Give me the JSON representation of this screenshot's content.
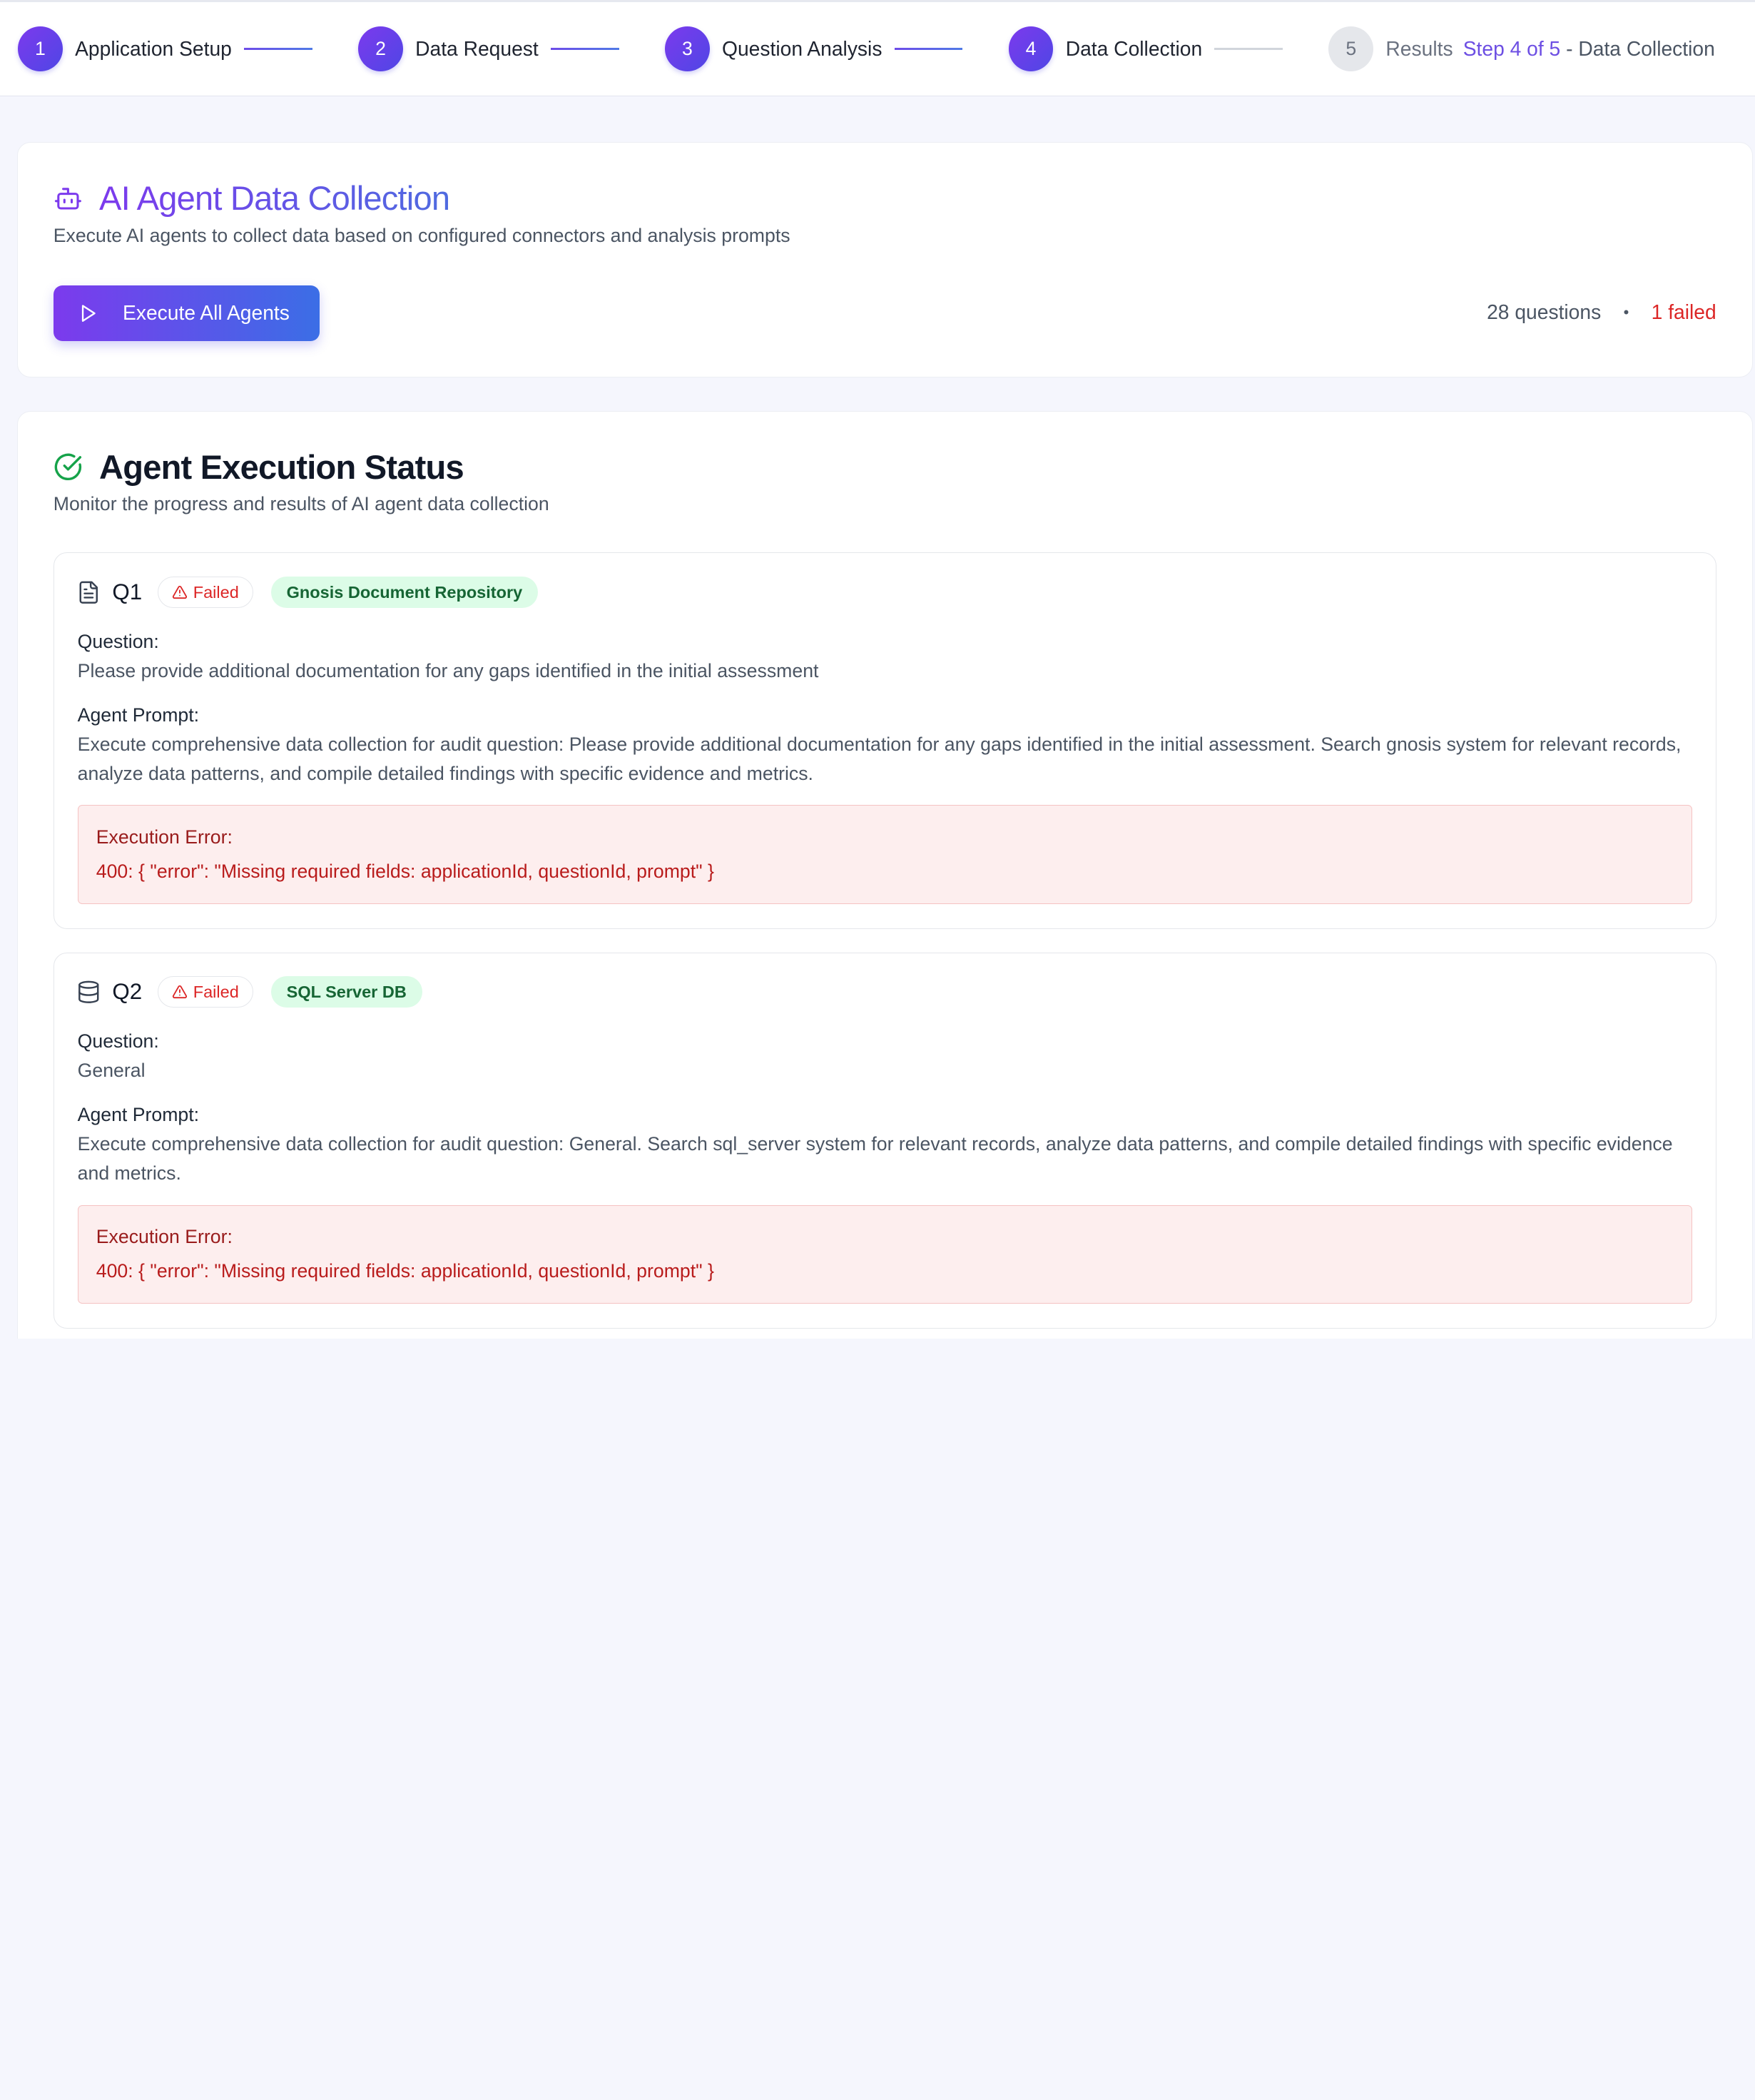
{
  "stepper": {
    "steps": [
      {
        "number": "1",
        "label": "Application Setup",
        "state": "complete"
      },
      {
        "number": "2",
        "label": "Data Request",
        "state": "complete"
      },
      {
        "number": "3",
        "label": "Question Analysis",
        "state": "complete"
      },
      {
        "number": "4",
        "label": "Data Collection",
        "state": "current"
      },
      {
        "number": "5",
        "label": "Results",
        "state": "upcoming"
      }
    ],
    "counter_highlight": "Step 4 of 5",
    "counter_rest": " - Data Collection"
  },
  "collection": {
    "icon": "bot-icon",
    "title": "AI Agent Data Collection",
    "subtitle": "Execute AI agents to collect data based on configured connectors and analysis prompts",
    "execute_button": "Execute All Agents",
    "questions_count": "28 questions",
    "separator": "•",
    "failed_count": "1 failed"
  },
  "status": {
    "icon": "check-circle-icon",
    "title": "Agent Execution Status",
    "subtitle": "Monitor the progress and results of AI agent data collection",
    "question_label": "Question:",
    "prompt_label": "Agent Prompt:",
    "error_label": "Execution Error:",
    "items": [
      {
        "id": "Q1",
        "icon": "document-icon",
        "status": "Failed",
        "source": "Gnosis Document Repository",
        "question": "Please provide additional documentation for any gaps identified in the initial assessment",
        "prompt": "Execute comprehensive data collection for audit question: Please provide additional documentation for any gaps identified in the initial assessment. Search gnosis system for relevant records, analyze data patterns, and compile detailed findings with specific evidence and metrics.",
        "error": "400: { \"error\": \"Missing required fields: applicationId, questionId, prompt\" }"
      },
      {
        "id": "Q2",
        "icon": "database-icon",
        "status": "Failed",
        "source": "SQL Server DB",
        "question": "General",
        "prompt": "Execute comprehensive data collection for audit question: General. Search sql_server system for relevant records, analyze data patterns, and compile detailed findings with specific evidence and metrics.",
        "error": "400: { \"error\": \"Missing required fields: applicationId, questionId, prompt\" }"
      }
    ]
  },
  "colors": {
    "accent_start": "#7c3aed",
    "accent_end": "#3b6ee6",
    "error": "#dc2626",
    "success_badge_bg": "#dcfce7",
    "success_badge_text": "#166534"
  }
}
